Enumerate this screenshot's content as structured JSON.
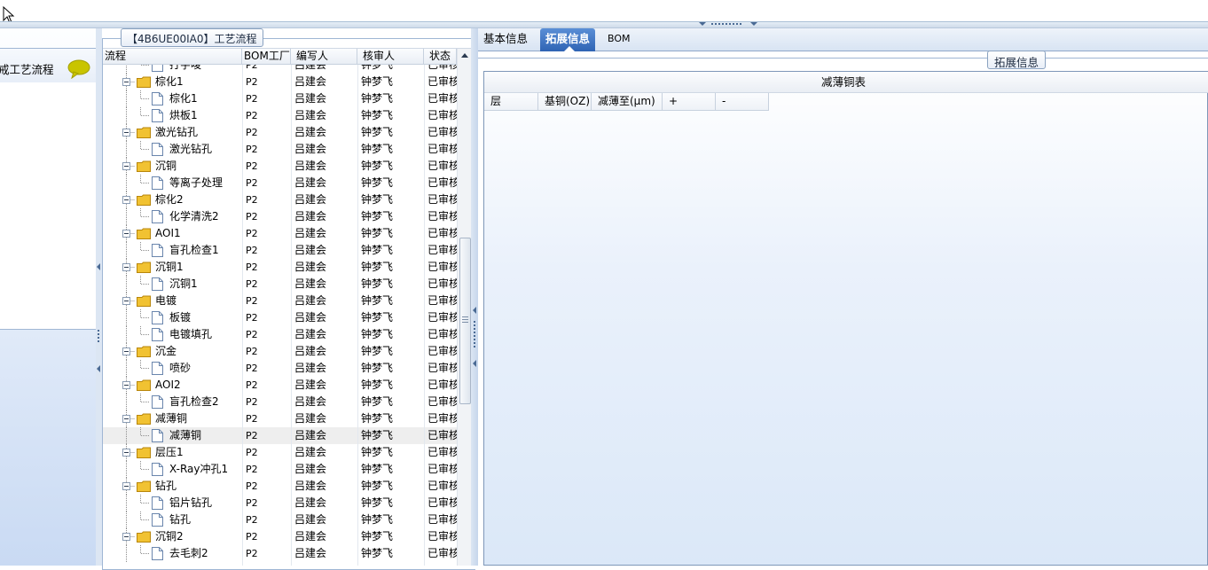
{
  "process_group": {
    "title": "【4B6UE00IA0】工艺流程"
  },
  "left_panel": {
    "item_label": "戒工艺流程"
  },
  "grid": {
    "columns": [
      "流程",
      "BOM工厂",
      "编写人",
      "核审人",
      "状态"
    ],
    "rows": [
      {
        "level": 2,
        "kind": "doc",
        "name": "打字唛",
        "factory": "P2",
        "writer": "吕建会",
        "reviewer": "钟梦飞",
        "status": "已审核"
      },
      {
        "level": 1,
        "kind": "folder",
        "name": "棕化1",
        "factory": "P2",
        "writer": "吕建会",
        "reviewer": "钟梦飞",
        "status": "已审核"
      },
      {
        "level": 2,
        "kind": "doc",
        "name": "棕化1",
        "factory": "P2",
        "writer": "吕建会",
        "reviewer": "钟梦飞",
        "status": "已审核"
      },
      {
        "level": 2,
        "kind": "doc",
        "name": "烘板1",
        "factory": "P2",
        "writer": "吕建会",
        "reviewer": "钟梦飞",
        "status": "已审核"
      },
      {
        "level": 1,
        "kind": "folder",
        "name": "激光钻孔",
        "factory": "P2",
        "writer": "吕建会",
        "reviewer": "钟梦飞",
        "status": "已审核"
      },
      {
        "level": 2,
        "kind": "doc",
        "name": "激光钻孔",
        "factory": "P2",
        "writer": "吕建会",
        "reviewer": "钟梦飞",
        "status": "已审核"
      },
      {
        "level": 1,
        "kind": "folder",
        "name": "沉铜",
        "factory": "P2",
        "writer": "吕建会",
        "reviewer": "钟梦飞",
        "status": "已审核"
      },
      {
        "level": 2,
        "kind": "doc",
        "name": "等离子处理",
        "factory": "P2",
        "writer": "吕建会",
        "reviewer": "钟梦飞",
        "status": "已审核"
      },
      {
        "level": 1,
        "kind": "folder",
        "name": "棕化2",
        "factory": "P2",
        "writer": "吕建会",
        "reviewer": "钟梦飞",
        "status": "已审核"
      },
      {
        "level": 2,
        "kind": "doc",
        "name": "化学清洗2",
        "factory": "P2",
        "writer": "吕建会",
        "reviewer": "钟梦飞",
        "status": "已审核"
      },
      {
        "level": 1,
        "kind": "folder",
        "name": "AOI1",
        "factory": "P2",
        "writer": "吕建会",
        "reviewer": "钟梦飞",
        "status": "已审核"
      },
      {
        "level": 2,
        "kind": "doc",
        "name": "盲孔检查1",
        "factory": "P2",
        "writer": "吕建会",
        "reviewer": "钟梦飞",
        "status": "已审核"
      },
      {
        "level": 1,
        "kind": "folder",
        "name": "沉铜1",
        "factory": "P2",
        "writer": "吕建会",
        "reviewer": "钟梦飞",
        "status": "已审核"
      },
      {
        "level": 2,
        "kind": "doc",
        "name": "沉铜1",
        "factory": "P2",
        "writer": "吕建会",
        "reviewer": "钟梦飞",
        "status": "已审核"
      },
      {
        "level": 1,
        "kind": "folder",
        "name": "电镀",
        "factory": "P2",
        "writer": "吕建会",
        "reviewer": "钟梦飞",
        "status": "已审核"
      },
      {
        "level": 2,
        "kind": "doc",
        "name": "板镀",
        "factory": "P2",
        "writer": "吕建会",
        "reviewer": "钟梦飞",
        "status": "已审核"
      },
      {
        "level": 2,
        "kind": "doc",
        "name": "电镀填孔",
        "factory": "P2",
        "writer": "吕建会",
        "reviewer": "钟梦飞",
        "status": "已审核"
      },
      {
        "level": 1,
        "kind": "folder",
        "name": "沉金",
        "factory": "P2",
        "writer": "吕建会",
        "reviewer": "钟梦飞",
        "status": "已审核"
      },
      {
        "level": 2,
        "kind": "doc",
        "name": "喷砂",
        "factory": "P2",
        "writer": "吕建会",
        "reviewer": "钟梦飞",
        "status": "已审核"
      },
      {
        "level": 1,
        "kind": "folder",
        "name": "AOI2",
        "factory": "P2",
        "writer": "吕建会",
        "reviewer": "钟梦飞",
        "status": "已审核"
      },
      {
        "level": 2,
        "kind": "doc",
        "name": "盲孔检查2",
        "factory": "P2",
        "writer": "吕建会",
        "reviewer": "钟梦飞",
        "status": "已审核"
      },
      {
        "level": 1,
        "kind": "folder",
        "name": "减薄铜",
        "factory": "P2",
        "writer": "吕建会",
        "reviewer": "钟梦飞",
        "status": "已审核"
      },
      {
        "level": 2,
        "kind": "doc",
        "name": "减薄铜",
        "factory": "P2",
        "writer": "吕建会",
        "reviewer": "钟梦飞",
        "status": "已审核",
        "selected": true
      },
      {
        "level": 1,
        "kind": "folder",
        "name": "层压1",
        "factory": "P2",
        "writer": "吕建会",
        "reviewer": "钟梦飞",
        "status": "已审核"
      },
      {
        "level": 2,
        "kind": "doc",
        "name": "X-Ray冲孔1",
        "factory": "P2",
        "writer": "吕建会",
        "reviewer": "钟梦飞",
        "status": "已审核"
      },
      {
        "level": 1,
        "kind": "folder",
        "name": "钻孔",
        "factory": "P2",
        "writer": "吕建会",
        "reviewer": "钟梦飞",
        "status": "已审核"
      },
      {
        "level": 2,
        "kind": "doc",
        "name": "铝片钻孔",
        "factory": "P2",
        "writer": "吕建会",
        "reviewer": "钟梦飞",
        "status": "已审核"
      },
      {
        "level": 2,
        "kind": "doc",
        "name": "钻孔",
        "factory": "P2",
        "writer": "吕建会",
        "reviewer": "钟梦飞",
        "status": "已审核"
      },
      {
        "level": 1,
        "kind": "folder",
        "name": "沉铜2",
        "factory": "P2",
        "writer": "吕建会",
        "reviewer": "钟梦飞",
        "status": "已审核"
      },
      {
        "level": 2,
        "kind": "doc",
        "name": "去毛刺2",
        "factory": "P2",
        "writer": "吕建会",
        "reviewer": "钟梦飞",
        "status": "已审核"
      }
    ]
  },
  "tabs": [
    {
      "label": "基本信息",
      "active": false
    },
    {
      "label": "拓展信息",
      "active": true
    },
    {
      "label": "BOM",
      "active": false
    }
  ],
  "ext_group": {
    "title": "拓展信息"
  },
  "thin_table": {
    "title": "减薄铜表",
    "columns": [
      "层",
      "基铜(OZ)",
      "减薄至(μm)",
      "+",
      "-"
    ]
  },
  "colors": {
    "accent_tab": "#2f64b4",
    "folder": "#f1c232",
    "chat_bubble": "#c9c400"
  }
}
